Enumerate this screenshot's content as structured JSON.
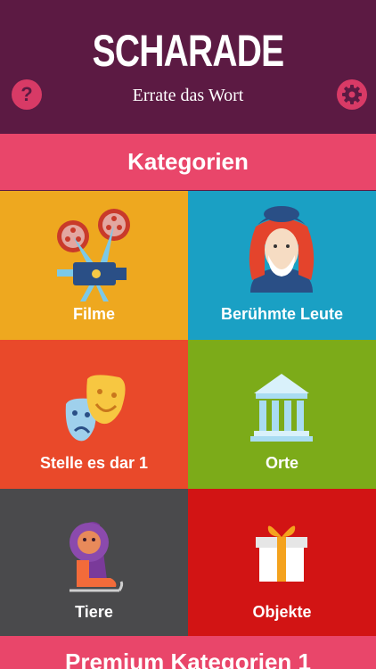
{
  "header": {
    "logo": "SCHARADE",
    "tagline": "Errate das Wort",
    "help_label": "?"
  },
  "section": {
    "title": "Kategorien"
  },
  "categories": [
    {
      "label": "Filme",
      "icon": "film-projector-icon",
      "color": "#eea81f"
    },
    {
      "label": "Berühmte Leute",
      "icon": "famous-person-icon",
      "color": "#1aa0c4"
    },
    {
      "label": "Stelle es dar 1",
      "icon": "theater-masks-icon",
      "color": "#e9492a"
    },
    {
      "label": "Orte",
      "icon": "temple-building-icon",
      "color": "#7cab19"
    },
    {
      "label": "Tiere",
      "icon": "lion-skating-icon",
      "color": "#4a4a4c"
    },
    {
      "label": "Objekte",
      "icon": "gift-box-icon",
      "color": "#d21414"
    }
  ],
  "premium": {
    "title": "Premium Kategorien 1"
  },
  "colors": {
    "header_bg": "#5c1a43",
    "accent": "#e9466a"
  }
}
